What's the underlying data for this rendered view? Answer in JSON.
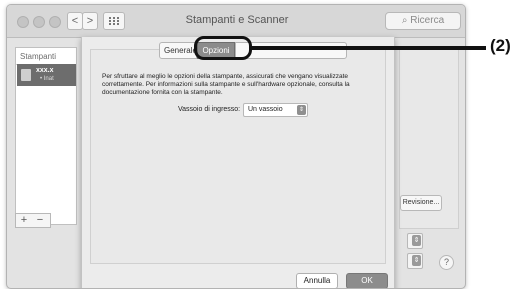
{
  "window": {
    "title": "Stampanti e Scanner",
    "search_placeholder": "Ricerca",
    "nav_back": "<",
    "nav_forward": ">",
    "grid_icon": "grid-icon"
  },
  "sidebar": {
    "header": "Stampanti",
    "printer_name": "xxx.x",
    "printer_status": "• Inat",
    "add_label": "+",
    "remove_label": "−"
  },
  "background": {
    "revision_button": "Revisione..."
  },
  "sheet": {
    "tabs": [
      {
        "label": "Generale"
      },
      {
        "label": "Opzioni"
      }
    ],
    "description": "Per sfruttare al meglio le opzioni della stampante, assicurati che vengano visualizzate correttamente. Per informazioni sulla stampante e sull'hardware opzionale, consulta la documentazione fornita con la stampante.",
    "tray_label": "Vassoio di ingresso:",
    "tray_value": "Un vassoio",
    "cancel_button": "Annulla",
    "ok_button": "OK"
  },
  "callout": {
    "label": "(2)"
  },
  "colors": {
    "active_tab": "#8c8c8c",
    "ok_button": "#8c8c8c",
    "callout": "#111111"
  }
}
